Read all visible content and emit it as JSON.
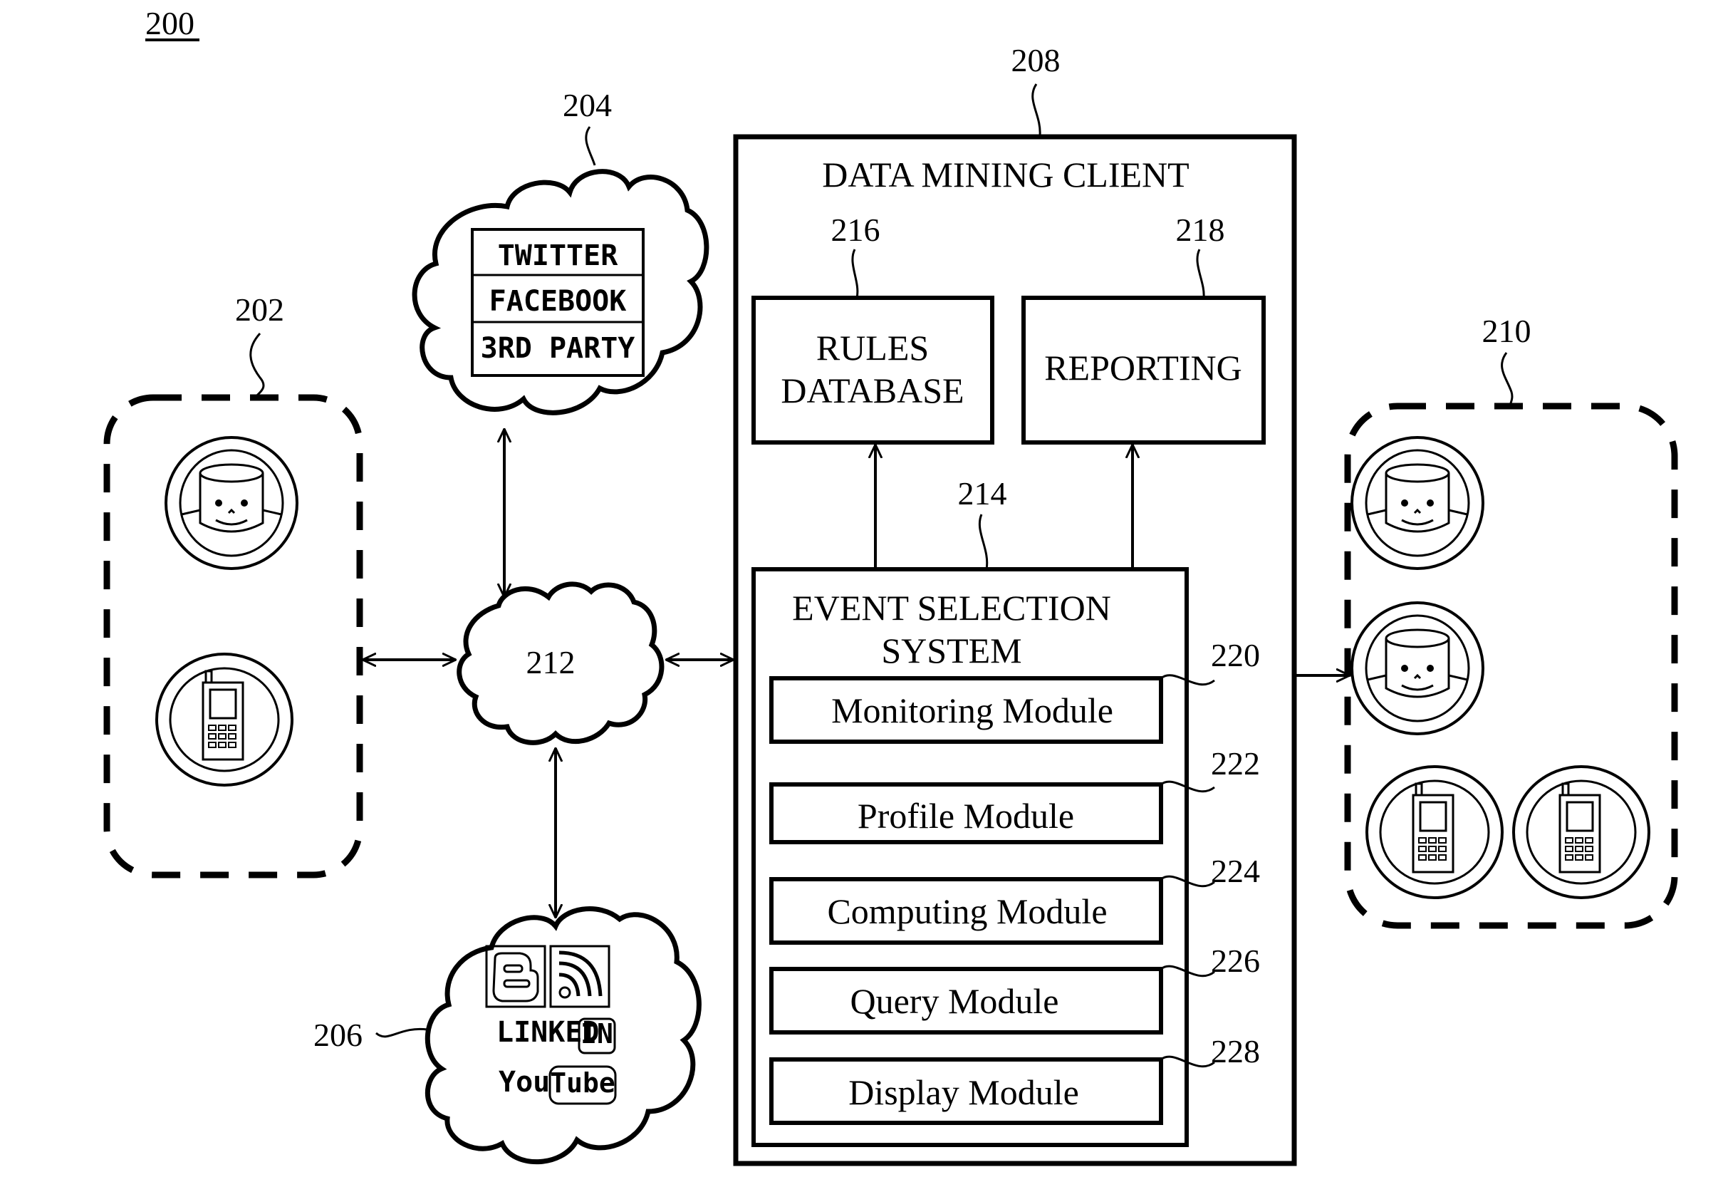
{
  "figure": {
    "number": "200",
    "type": "system block diagram"
  },
  "user_group_source": {
    "ref": "202",
    "icons": [
      "user-avatar",
      "mobile-phone"
    ]
  },
  "social_networks_primary": {
    "ref": "204",
    "entries": [
      "TWITTER",
      "FACEBOOK",
      "3RD PARTY"
    ]
  },
  "social_networks_secondary": {
    "ref": "206",
    "icons": [
      "blogger",
      "rss-feed"
    ],
    "linkedin": {
      "prefix": "LINKED",
      "badge": "IN"
    },
    "youtube": {
      "prefix": "You",
      "badge": "Tube"
    }
  },
  "network": {
    "ref": "212"
  },
  "data_mining_client": {
    "ref": "208",
    "title": "DATA MINING CLIENT",
    "rules_database": {
      "ref": "216",
      "line1": "RULES",
      "line2": "DATABASE"
    },
    "reporting": {
      "ref": "218",
      "label": "REPORTING"
    },
    "event_selection_system": {
      "ref": "214",
      "line1": "EVENT SELECTION",
      "line2": "SYSTEM",
      "modules": [
        {
          "ref": "220",
          "label": "Monitoring Module"
        },
        {
          "ref": "222",
          "label": "Profile Module"
        },
        {
          "ref": "224",
          "label": "Computing Module"
        },
        {
          "ref": "226",
          "label": "Query Module"
        },
        {
          "ref": "228",
          "label": "Display Module"
        }
      ]
    }
  },
  "target_group": {
    "ref": "210",
    "icons": [
      "user-avatar",
      "user-avatar",
      "mobile-phone",
      "mobile-phone"
    ]
  }
}
